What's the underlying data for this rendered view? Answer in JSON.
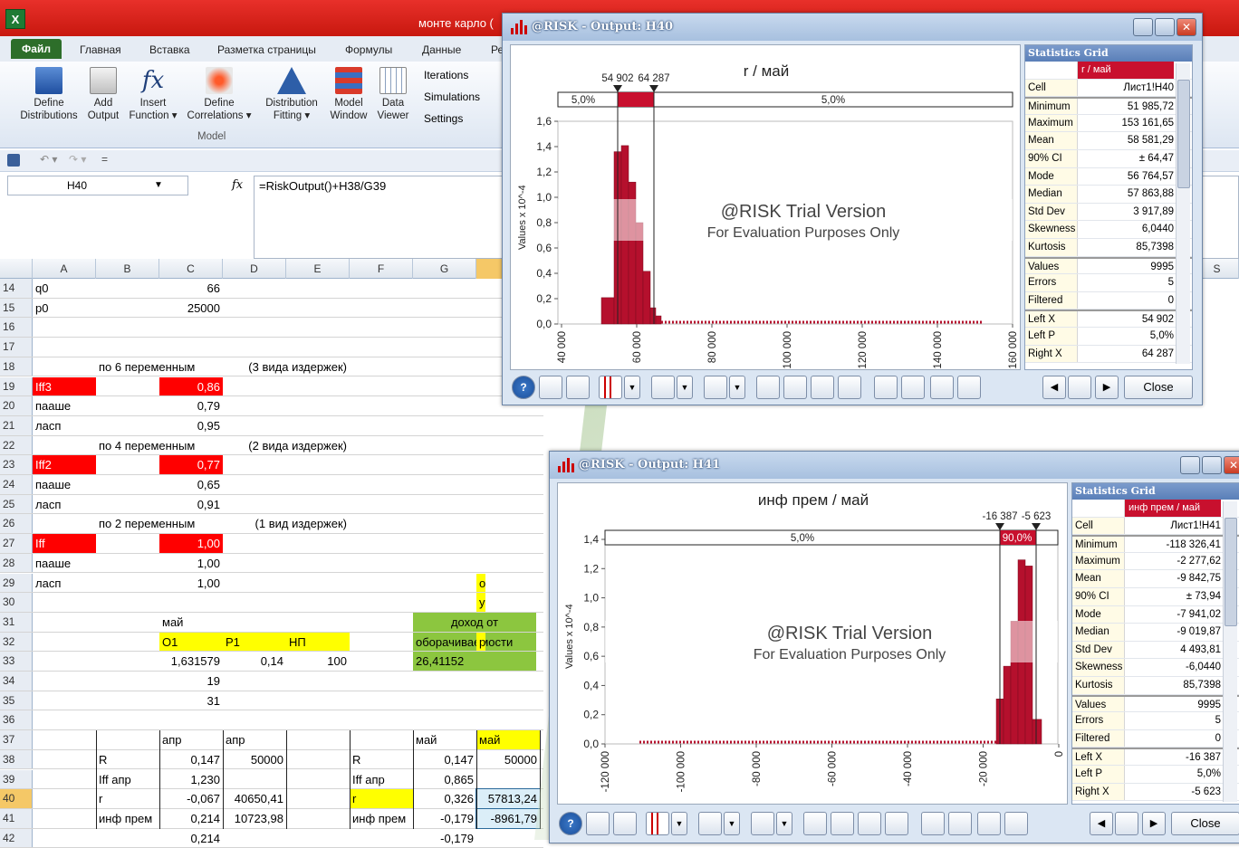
{
  "excel": {
    "title": "монте карло (",
    "tabs": [
      "Файл",
      "Главная",
      "Вставка",
      "Разметка страницы",
      "Формулы",
      "Данные",
      "Ре"
    ],
    "ribbon_buttons": [
      {
        "label": "Define\nDistributions"
      },
      {
        "label": "Add\nOutput"
      },
      {
        "label": "Insert\nFunction ▾"
      },
      {
        "label": "Define\nCorrelations ▾"
      },
      {
        "label": "Distribution\nFitting ▾"
      },
      {
        "label": "Model\nWindow"
      },
      {
        "label": "Data\nViewer"
      }
    ],
    "ribbon_side": [
      "Iterations",
      "Simulations",
      "Settings"
    ],
    "group_label": "Model",
    "namebox": "H40",
    "formula": "=RiskOutput()+H38/G39",
    "columns": [
      "A",
      "B",
      "C",
      "D",
      "E",
      "F",
      "G"
    ],
    "extra_column": "S",
    "rows": [
      {
        "n": "14",
        "cells": {
          "A": "q0",
          "C": "66"
        }
      },
      {
        "n": "15",
        "cells": {
          "A": "p0",
          "C": "25000"
        }
      },
      {
        "n": "16",
        "cells": {}
      },
      {
        "n": "17",
        "cells": {}
      },
      {
        "n": "18",
        "cells": {
          "B": "по 6 переменным",
          "D": "(3 вида издержек)"
        }
      },
      {
        "n": "19",
        "cells": {
          "A": "Iff3",
          "C": "0,86"
        }
      },
      {
        "n": "20",
        "cells": {
          "A": "пааше",
          "C": "0,79"
        }
      },
      {
        "n": "21",
        "cells": {
          "A": "ласп",
          "C": "0,95"
        }
      },
      {
        "n": "22",
        "cells": {
          "B": "по 4 переменным",
          "D": "(2 вида издержек)"
        }
      },
      {
        "n": "23",
        "cells": {
          "A": "Iff2",
          "C": "0,77"
        }
      },
      {
        "n": "24",
        "cells": {
          "A": "пааше",
          "C": "0,65"
        }
      },
      {
        "n": "25",
        "cells": {
          "A": "ласп",
          "C": "0,91"
        }
      },
      {
        "n": "26",
        "cells": {
          "B": "по 2 переменным",
          "D": "(1 вид издержек)"
        }
      },
      {
        "n": "27",
        "cells": {
          "A": "Iff",
          "C": "1,00"
        }
      },
      {
        "n": "28",
        "cells": {
          "A": "пааше",
          "C": "1,00"
        }
      },
      {
        "n": "29",
        "cells": {
          "A": "ласп",
          "C": "1,00",
          "H": "о"
        }
      },
      {
        "n": "30",
        "cells": {
          "H": "у"
        }
      },
      {
        "n": "31",
        "cells": {
          "C": "май",
          "G": "доход от"
        }
      },
      {
        "n": "32",
        "cells": {
          "C": "О1",
          "D": "Р1",
          "E": "НП",
          "G": "оборачиваемости",
          "H": "р"
        }
      },
      {
        "n": "33",
        "cells": {
          "C": "1,631579",
          "D": "0,14",
          "E": "100",
          "G": "26,41152"
        }
      },
      {
        "n": "34",
        "cells": {
          "C": "19"
        }
      },
      {
        "n": "35",
        "cells": {
          "C": "31"
        }
      },
      {
        "n": "36",
        "cells": {}
      },
      {
        "n": "37",
        "cells": {
          "C": "апр",
          "D": "апр",
          "G": "май",
          "H": "май"
        }
      },
      {
        "n": "38",
        "cells": {
          "B": "R",
          "C": "0,147",
          "D": "50000",
          "F": "R",
          "G": "0,147",
          "H": "50000"
        }
      },
      {
        "n": "39",
        "cells": {
          "B": "Iff апр",
          "C": "1,230",
          "F": "Iff апр",
          "G": "0,865"
        }
      },
      {
        "n": "40",
        "cells": {
          "B": "r",
          "C": "-0,067",
          "D": "40650,41",
          "F": "r",
          "G": "0,326",
          "H": "57813,24"
        }
      },
      {
        "n": "41",
        "cells": {
          "B": "инф прем",
          "C": "0,214",
          "D": "10723,98",
          "F": "инф прем",
          "G": "-0,179",
          "H": "-8961,79"
        }
      },
      {
        "n": "42",
        "cells": {
          "C": "0,214",
          "G": "-0,179"
        }
      }
    ]
  },
  "win1": {
    "title": "@RISK - Output: H40",
    "chart": {
      "title": "r / май",
      "left_mark": "54 902",
      "right_mark": "64 287",
      "left_pct": "5,0%",
      "right_pct": "5,0%",
      "ylabel": "Values x 10^-4",
      "yticks": [
        "1,6",
        "1,4",
        "1,2",
        "1,0",
        "0,8",
        "0,6",
        "0,4",
        "0,2",
        "0,0"
      ],
      "xticks": [
        "40 000",
        "60 000",
        "80 000",
        "100 000",
        "120 000",
        "140 000",
        "160 000"
      ],
      "watermark1": "@RISK Trial Version",
      "watermark2": "For Evaluation Purposes Only"
    },
    "stats": {
      "header": "Statistics Grid",
      "col": "r / май",
      "rows": [
        [
          "Cell",
          "Лист1!H40"
        ],
        [
          "Minimum",
          "51 985,72"
        ],
        [
          "Maximum",
          "153 161,65"
        ],
        [
          "Mean",
          "58 581,29"
        ],
        [
          "90% CI",
          "± 64,47"
        ],
        [
          "Mode",
          "56 764,57"
        ],
        [
          "Median",
          "57 863,88"
        ],
        [
          "Std Dev",
          "3 917,89"
        ],
        [
          "Skewness",
          "6,0440"
        ],
        [
          "Kurtosis",
          "85,7398"
        ],
        [
          "Values",
          "9995"
        ],
        [
          "Errors",
          "5"
        ],
        [
          "Filtered",
          "0"
        ],
        [
          "Left X",
          "54 902"
        ],
        [
          "Left P",
          "5,0%"
        ],
        [
          "Right X",
          "64 287"
        ]
      ]
    },
    "close": "Close"
  },
  "win2": {
    "title": "@RISK - Output: H41",
    "chart": {
      "title": "инф прем / май",
      "left_mark": "-16 387",
      "right_mark": "-5 623",
      "left_pct": "5,0%",
      "right_pct": "90,0%",
      "ylabel": "Values x 10^-4",
      "yticks": [
        "1,4",
        "1,2",
        "1,0",
        "0,8",
        "0,6",
        "0,4",
        "0,2",
        "0,0"
      ],
      "xticks": [
        "-120 000",
        "-100 000",
        "-80 000",
        "-60 000",
        "-40 000",
        "-20 000",
        "0"
      ],
      "watermark1": "@RISK Trial Version",
      "watermark2": "For Evaluation Purposes Only"
    },
    "stats": {
      "header": "Statistics Grid",
      "col": "инф прем / май",
      "rows": [
        [
          "Cell",
          "Лист1!H41"
        ],
        [
          "Minimum",
          "-118 326,41"
        ],
        [
          "Maximum",
          "-2 277,62"
        ],
        [
          "Mean",
          "-9 842,75"
        ],
        [
          "90% CI",
          "± 73,94"
        ],
        [
          "Mode",
          "-7 941,02"
        ],
        [
          "Median",
          "-9 019,87"
        ],
        [
          "Std Dev",
          "4 493,81"
        ],
        [
          "Skewness",
          "-6,0440"
        ],
        [
          "Kurtosis",
          "85,7398"
        ],
        [
          "Values",
          "9995"
        ],
        [
          "Errors",
          "5"
        ],
        [
          "Filtered",
          "0"
        ],
        [
          "Left X",
          "-16 387"
        ],
        [
          "Left P",
          "5,0%"
        ],
        [
          "Right X",
          "-5 623"
        ]
      ]
    },
    "close": "Close"
  },
  "colors": {
    "excel_red": "#e02a20",
    "bar": "#b5102d",
    "green": "#8cc63f",
    "yellow": "#ffff00"
  }
}
